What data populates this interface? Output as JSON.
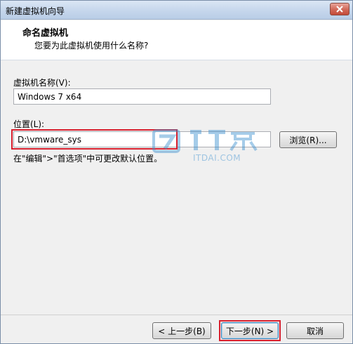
{
  "window": {
    "title": "新建虚拟机向导"
  },
  "header": {
    "title": "命名虚拟机",
    "subtitle": "您要为此虚拟机使用什么名称?"
  },
  "form": {
    "name_label": "虚拟机名称(V):",
    "name_value": "Windows 7 x64",
    "location_label": "位置(L):",
    "location_value": "D:\\vmware_sys",
    "browse_label": "浏览(R)...",
    "hint": "在\"编辑\">\"首选项\"中可更改默认位置。"
  },
  "watermark": {
    "text": "ITDAI.COM"
  },
  "footer": {
    "back_label": "< 上一步(B)",
    "next_label": "下一步(N) >",
    "cancel_label": "取消"
  },
  "colors": {
    "highlight": "#d8202e",
    "watermark": "#3a8fd0"
  }
}
